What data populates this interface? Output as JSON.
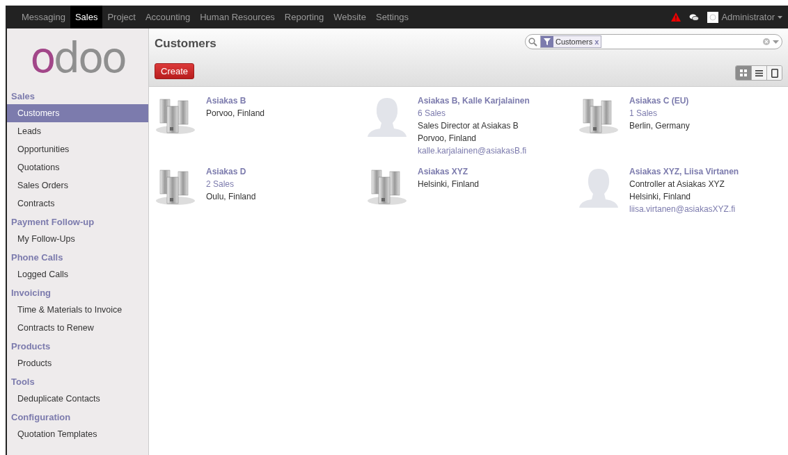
{
  "top_menu": [
    {
      "label": "Messaging",
      "selected": false
    },
    {
      "label": "Sales",
      "selected": true
    },
    {
      "label": "Project",
      "selected": false
    },
    {
      "label": "Accounting",
      "selected": false
    },
    {
      "label": "Human Resources",
      "selected": false
    },
    {
      "label": "Reporting",
      "selected": false
    },
    {
      "label": "Website",
      "selected": false
    },
    {
      "label": "Settings",
      "selected": false
    }
  ],
  "user": {
    "name": "Administrator"
  },
  "logo": "odoo",
  "sidebar": [
    {
      "heading": "Sales",
      "items": [
        {
          "label": "Customers",
          "selected": true
        },
        {
          "label": "Leads",
          "selected": false
        },
        {
          "label": "Opportunities",
          "selected": false
        },
        {
          "label": "Quotations",
          "selected": false
        },
        {
          "label": "Sales Orders",
          "selected": false
        },
        {
          "label": "Contracts",
          "selected": false
        }
      ]
    },
    {
      "heading": "Payment Follow-up",
      "items": [
        {
          "label": "My Follow-Ups",
          "selected": false
        }
      ]
    },
    {
      "heading": "Phone Calls",
      "items": [
        {
          "label": "Logged Calls",
          "selected": false
        }
      ]
    },
    {
      "heading": "Invoicing",
      "items": [
        {
          "label": "Time & Materials to Invoice",
          "selected": false
        },
        {
          "label": "Contracts to Renew",
          "selected": false
        }
      ]
    },
    {
      "heading": "Products",
      "items": [
        {
          "label": "Products",
          "selected": false
        }
      ]
    },
    {
      "heading": "Tools",
      "items": [
        {
          "label": "Deduplicate Contacts",
          "selected": false
        }
      ]
    },
    {
      "heading": "Configuration",
      "items": [
        {
          "label": "Quotation Templates",
          "selected": false
        }
      ]
    }
  ],
  "page_title": "Customers",
  "create_button": "Create",
  "search": {
    "facets": [
      {
        "label": "Customers",
        "remove": "x"
      }
    ]
  },
  "view_switcher": [
    {
      "kind": "kanban",
      "selected": true
    },
    {
      "kind": "list",
      "selected": false
    },
    {
      "kind": "form",
      "selected": false
    }
  ],
  "cards": [
    {
      "kind": "company",
      "name": "Asiakas B",
      "lines": [
        {
          "kind": "text",
          "text": "Porvoo, Finland"
        }
      ]
    },
    {
      "kind": "person",
      "name": "Asiakas B, Kalle Karjalainen",
      "lines": [
        {
          "kind": "link",
          "text": "6 Sales"
        },
        {
          "kind": "text",
          "text": "Sales Director at Asiakas B"
        },
        {
          "kind": "text",
          "text": "Porvoo, Finland"
        },
        {
          "kind": "link",
          "text": "kalle.karjalainen@asiakasB.fi"
        }
      ]
    },
    {
      "kind": "company",
      "name": "Asiakas C (EU)",
      "lines": [
        {
          "kind": "link",
          "text": "1 Sales"
        },
        {
          "kind": "text",
          "text": "Berlin, Germany"
        }
      ]
    },
    {
      "kind": "company",
      "name": "Asiakas D",
      "lines": [
        {
          "kind": "link",
          "text": "2 Sales"
        },
        {
          "kind": "text",
          "text": "Oulu, Finland"
        }
      ]
    },
    {
      "kind": "company",
      "name": "Asiakas XYZ",
      "lines": [
        {
          "kind": "text",
          "text": "Helsinki, Finland"
        }
      ]
    },
    {
      "kind": "person",
      "name": "Asiakas XYZ, Liisa Virtanen",
      "lines": [
        {
          "kind": "text",
          "text": "Controller at Asiakas XYZ"
        },
        {
          "kind": "text",
          "text": "Helsinki, Finland"
        },
        {
          "kind": "link",
          "text": "liisa.virtanen@asiakasXYZ.fi"
        }
      ]
    }
  ]
}
